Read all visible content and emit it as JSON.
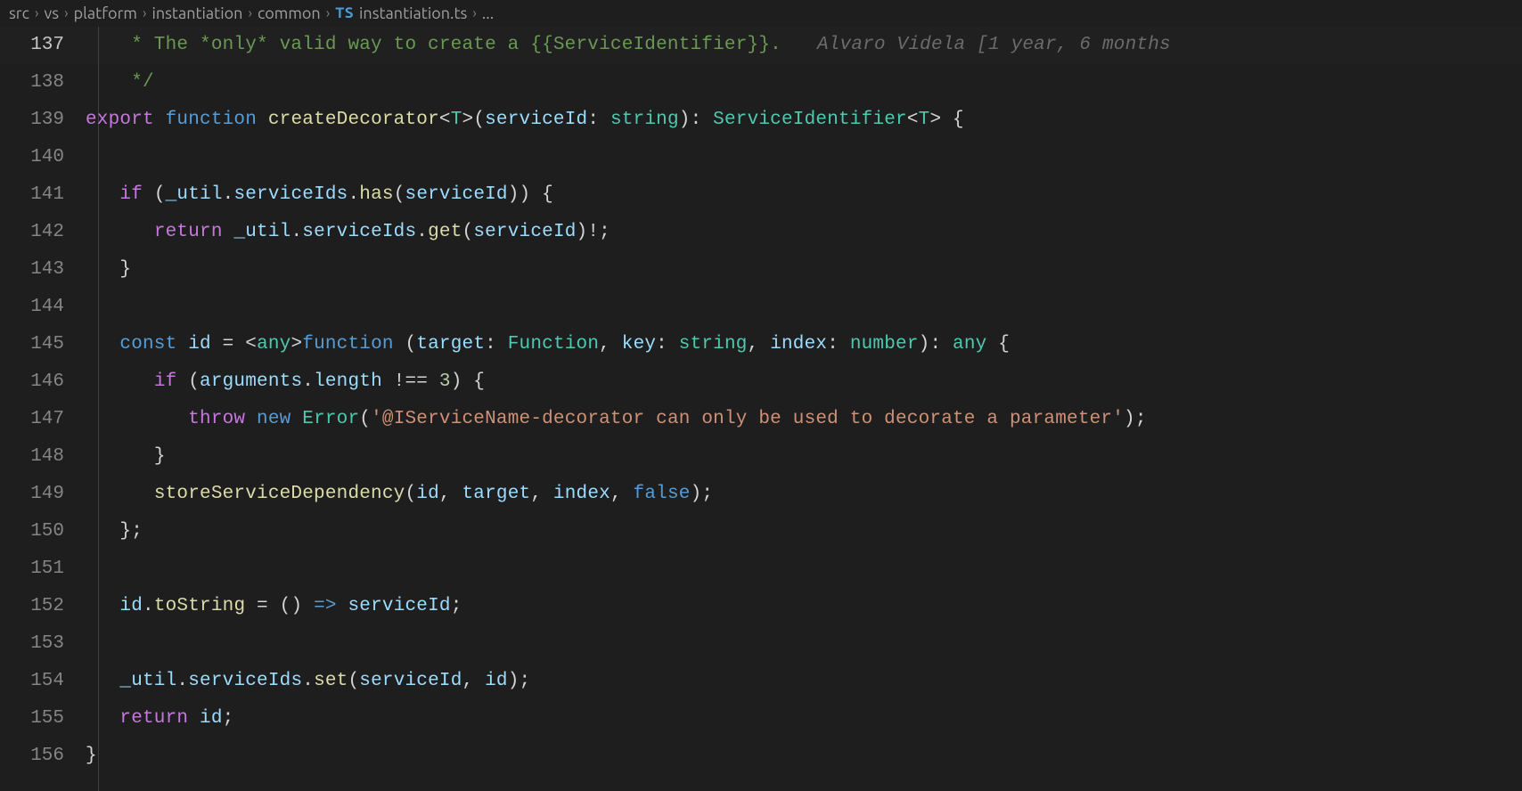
{
  "breadcrumbs": {
    "items": [
      "src",
      "vs",
      "platform",
      "instantiation",
      "common"
    ],
    "fileBadge": "TS",
    "file": "instantiation.ts",
    "trailing": "..."
  },
  "blame": "Alvaro Videla [1 year, 6 months",
  "startLine": 137,
  "lines": [
    {
      "n": 137,
      "indent": 1,
      "current": true,
      "blame": true,
      "tokens": [
        {
          "t": " * The *only* valid way to create a {{ServiceIdentifier}}.",
          "c": "c-comment"
        }
      ]
    },
    {
      "n": 138,
      "indent": 1,
      "tokens": [
        {
          "t": " */",
          "c": "c-comment"
        }
      ]
    },
    {
      "n": 139,
      "indent": 0,
      "tokens": [
        {
          "t": "export",
          "c": "c-purple"
        },
        {
          "t": " "
        },
        {
          "t": "function",
          "c": "c-blue"
        },
        {
          "t": " "
        },
        {
          "t": "createDecorator",
          "c": "c-func"
        },
        {
          "t": "<",
          "c": "c-punc"
        },
        {
          "t": "T",
          "c": "c-type"
        },
        {
          "t": ">(",
          "c": "c-punc"
        },
        {
          "t": "serviceId",
          "c": "c-param"
        },
        {
          "t": ": ",
          "c": "c-punc"
        },
        {
          "t": "string",
          "c": "c-type"
        },
        {
          "t": "): ",
          "c": "c-punc"
        },
        {
          "t": "ServiceIdentifier",
          "c": "c-type"
        },
        {
          "t": "<",
          "c": "c-punc"
        },
        {
          "t": "T",
          "c": "c-type"
        },
        {
          "t": "> {",
          "c": "c-punc"
        }
      ]
    },
    {
      "n": 140,
      "indent": 1,
      "tokens": []
    },
    {
      "n": 141,
      "indent": 1,
      "tokens": [
        {
          "t": "if",
          "c": "c-purple"
        },
        {
          "t": " (",
          "c": "c-punc"
        },
        {
          "t": "_util",
          "c": "c-var"
        },
        {
          "t": ".",
          "c": "c-punc"
        },
        {
          "t": "serviceIds",
          "c": "c-prop"
        },
        {
          "t": ".",
          "c": "c-punc"
        },
        {
          "t": "has",
          "c": "c-func"
        },
        {
          "t": "(",
          "c": "c-punc"
        },
        {
          "t": "serviceId",
          "c": "c-var"
        },
        {
          "t": ")) {",
          "c": "c-punc"
        }
      ]
    },
    {
      "n": 142,
      "indent": 2,
      "tokens": [
        {
          "t": "return",
          "c": "c-purple"
        },
        {
          "t": " "
        },
        {
          "t": "_util",
          "c": "c-var"
        },
        {
          "t": ".",
          "c": "c-punc"
        },
        {
          "t": "serviceIds",
          "c": "c-prop"
        },
        {
          "t": ".",
          "c": "c-punc"
        },
        {
          "t": "get",
          "c": "c-func"
        },
        {
          "t": "(",
          "c": "c-punc"
        },
        {
          "t": "serviceId",
          "c": "c-var"
        },
        {
          "t": ")!;",
          "c": "c-punc"
        }
      ]
    },
    {
      "n": 143,
      "indent": 1,
      "tokens": [
        {
          "t": "}",
          "c": "c-punc"
        }
      ]
    },
    {
      "n": 144,
      "indent": 1,
      "tokens": []
    },
    {
      "n": 145,
      "indent": 1,
      "tokens": [
        {
          "t": "const",
          "c": "c-blue"
        },
        {
          "t": " "
        },
        {
          "t": "id",
          "c": "c-var"
        },
        {
          "t": " = <",
          "c": "c-punc"
        },
        {
          "t": "any",
          "c": "c-type"
        },
        {
          "t": ">",
          "c": "c-punc"
        },
        {
          "t": "function",
          "c": "c-blue"
        },
        {
          "t": " (",
          "c": "c-punc"
        },
        {
          "t": "target",
          "c": "c-param"
        },
        {
          "t": ": ",
          "c": "c-punc"
        },
        {
          "t": "Function",
          "c": "c-type"
        },
        {
          "t": ", ",
          "c": "c-punc"
        },
        {
          "t": "key",
          "c": "c-param"
        },
        {
          "t": ": ",
          "c": "c-punc"
        },
        {
          "t": "string",
          "c": "c-type"
        },
        {
          "t": ", ",
          "c": "c-punc"
        },
        {
          "t": "index",
          "c": "c-param"
        },
        {
          "t": ": ",
          "c": "c-punc"
        },
        {
          "t": "number",
          "c": "c-type"
        },
        {
          "t": "): ",
          "c": "c-punc"
        },
        {
          "t": "any",
          "c": "c-type"
        },
        {
          "t": " {",
          "c": "c-punc"
        }
      ]
    },
    {
      "n": 146,
      "indent": 2,
      "tokens": [
        {
          "t": "if",
          "c": "c-purple"
        },
        {
          "t": " (",
          "c": "c-punc"
        },
        {
          "t": "arguments",
          "c": "c-var"
        },
        {
          "t": ".",
          "c": "c-punc"
        },
        {
          "t": "length",
          "c": "c-prop"
        },
        {
          "t": " !== ",
          "c": "c-op"
        },
        {
          "t": "3",
          "c": "c-number"
        },
        {
          "t": ") {",
          "c": "c-punc"
        }
      ]
    },
    {
      "n": 147,
      "indent": 3,
      "tokens": [
        {
          "t": "throw",
          "c": "c-purple"
        },
        {
          "t": " "
        },
        {
          "t": "new",
          "c": "c-blue"
        },
        {
          "t": " "
        },
        {
          "t": "Error",
          "c": "c-type"
        },
        {
          "t": "(",
          "c": "c-punc"
        },
        {
          "t": "'@IServiceName-decorator can only be used to decorate a parameter'",
          "c": "c-string"
        },
        {
          "t": ");",
          "c": "c-punc"
        }
      ]
    },
    {
      "n": 148,
      "indent": 2,
      "tokens": [
        {
          "t": "}",
          "c": "c-punc"
        }
      ]
    },
    {
      "n": 149,
      "indent": 2,
      "tokens": [
        {
          "t": "storeServiceDependency",
          "c": "c-func"
        },
        {
          "t": "(",
          "c": "c-punc"
        },
        {
          "t": "id",
          "c": "c-var"
        },
        {
          "t": ", ",
          "c": "c-punc"
        },
        {
          "t": "target",
          "c": "c-var"
        },
        {
          "t": ", ",
          "c": "c-punc"
        },
        {
          "t": "index",
          "c": "c-var"
        },
        {
          "t": ", ",
          "c": "c-punc"
        },
        {
          "t": "false",
          "c": "c-blue"
        },
        {
          "t": ");",
          "c": "c-punc"
        }
      ]
    },
    {
      "n": 150,
      "indent": 1,
      "tokens": [
        {
          "t": "};",
          "c": "c-punc"
        }
      ]
    },
    {
      "n": 151,
      "indent": 1,
      "tokens": []
    },
    {
      "n": 152,
      "indent": 1,
      "tokens": [
        {
          "t": "id",
          "c": "c-var"
        },
        {
          "t": ".",
          "c": "c-punc"
        },
        {
          "t": "toString",
          "c": "c-func"
        },
        {
          "t": " = () ",
          "c": "c-punc"
        },
        {
          "t": "=>",
          "c": "c-blue"
        },
        {
          "t": " "
        },
        {
          "t": "serviceId",
          "c": "c-var"
        },
        {
          "t": ";",
          "c": "c-punc"
        }
      ]
    },
    {
      "n": 153,
      "indent": 1,
      "tokens": []
    },
    {
      "n": 154,
      "indent": 1,
      "tokens": [
        {
          "t": "_util",
          "c": "c-var"
        },
        {
          "t": ".",
          "c": "c-punc"
        },
        {
          "t": "serviceIds",
          "c": "c-prop"
        },
        {
          "t": ".",
          "c": "c-punc"
        },
        {
          "t": "set",
          "c": "c-func"
        },
        {
          "t": "(",
          "c": "c-punc"
        },
        {
          "t": "serviceId",
          "c": "c-var"
        },
        {
          "t": ", ",
          "c": "c-punc"
        },
        {
          "t": "id",
          "c": "c-var"
        },
        {
          "t": ");",
          "c": "c-punc"
        }
      ]
    },
    {
      "n": 155,
      "indent": 1,
      "tokens": [
        {
          "t": "return",
          "c": "c-purple"
        },
        {
          "t": " "
        },
        {
          "t": "id",
          "c": "c-var"
        },
        {
          "t": ";",
          "c": "c-punc"
        }
      ]
    },
    {
      "n": 156,
      "indent": 0,
      "tokens": [
        {
          "t": "}",
          "c": "c-punc"
        }
      ]
    }
  ]
}
